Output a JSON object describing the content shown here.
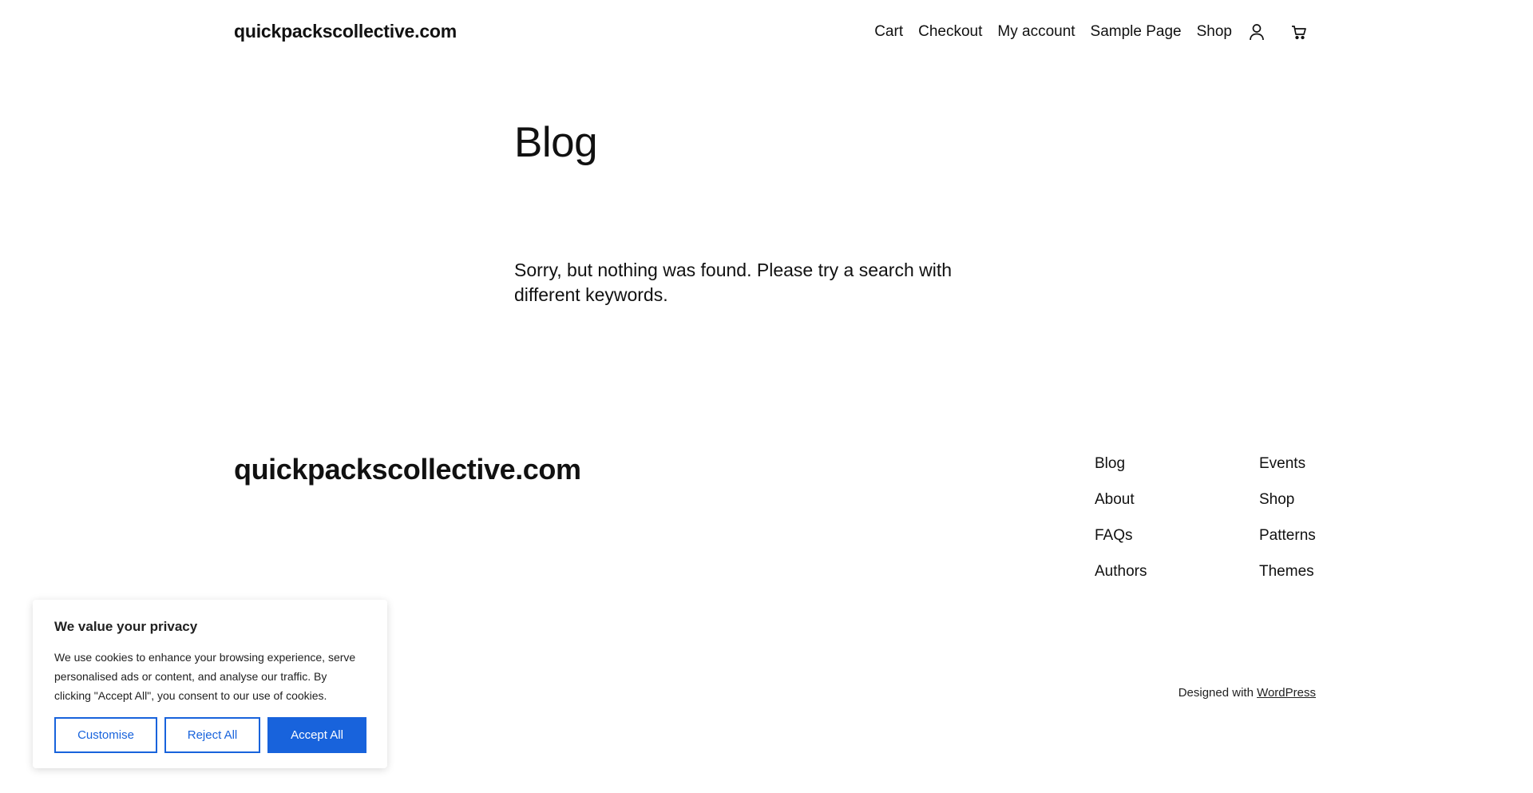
{
  "header": {
    "site_title": "quickpackscollective.com",
    "nav": [
      "Cart",
      "Checkout",
      "My account",
      "Sample Page",
      "Shop"
    ],
    "icons": [
      "account-icon",
      "cart-icon"
    ]
  },
  "main": {
    "title": "Blog",
    "message": "Sorry, but nothing was found. Please try a search with different keywords."
  },
  "footer": {
    "site_title": "quickpackscollective.com",
    "column_one": [
      "Blog",
      "About",
      "FAQs",
      "Authors"
    ],
    "column_two": [
      "Events",
      "Shop",
      "Patterns",
      "Themes"
    ],
    "credit_prefix": "Designed with ",
    "credit_link": "WordPress"
  },
  "cookie_banner": {
    "heading": "We value your privacy",
    "text": "We use cookies to enhance your browsing experience, serve personalised ads or content, and analyse our traffic. By clicking \"Accept All\", you consent to our use of cookies.",
    "customise_label": "Customise",
    "reject_label": "Reject All",
    "accept_label": "Accept All",
    "accent_color": "#1863dc"
  }
}
